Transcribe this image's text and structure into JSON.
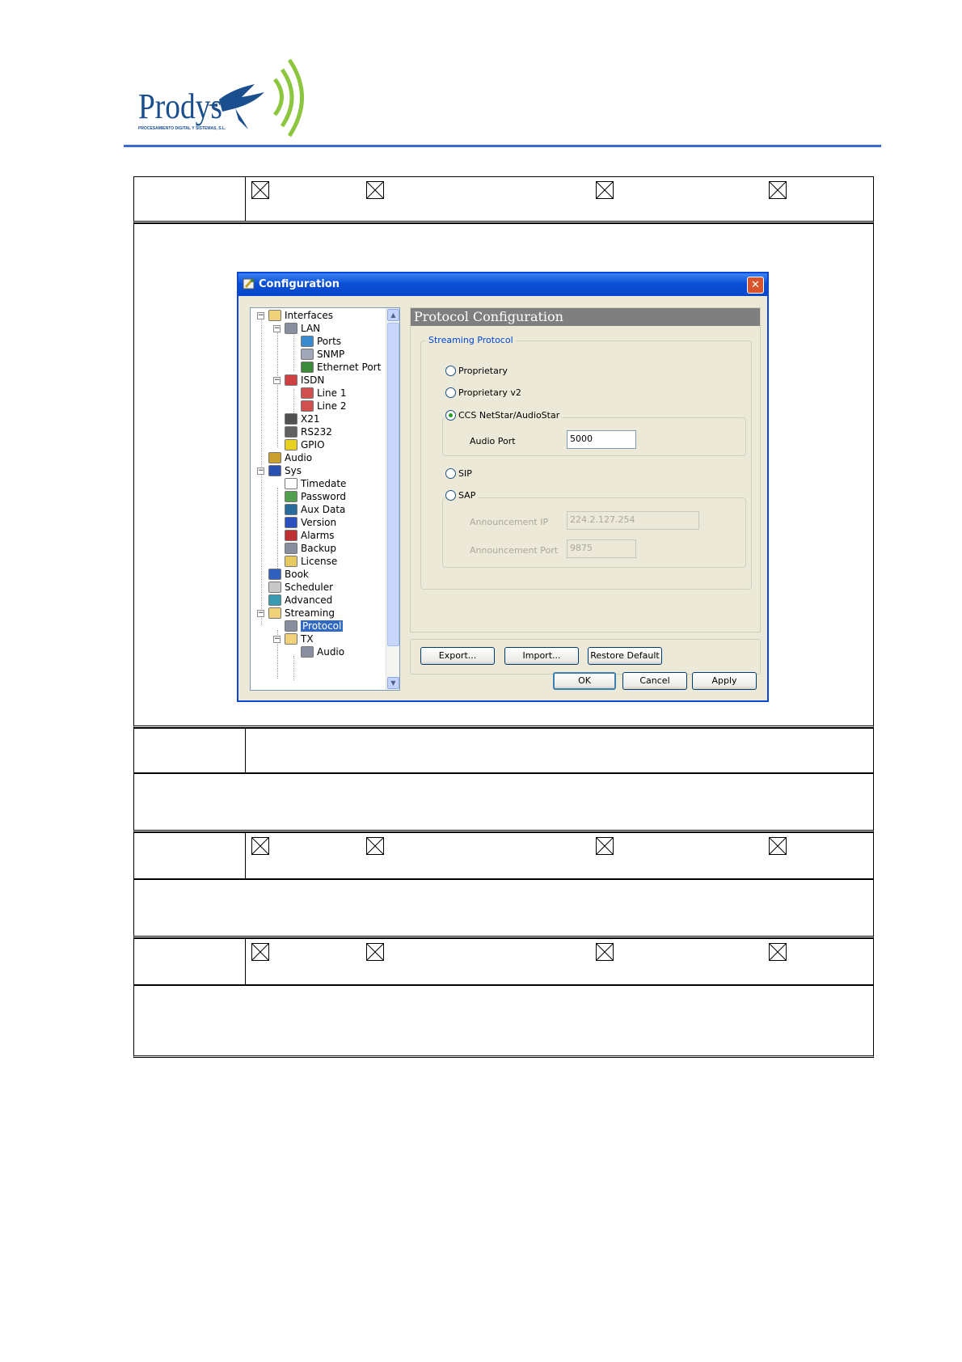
{
  "header": {
    "logo_text": "Prodys",
    "logo_subtitle": "PROCESAMIENTO DIGITAL Y SISTEMAS, S.L.",
    "accent_color": "#3a6ad4"
  },
  "dialog": {
    "title": "Configuration",
    "close_glyph": "✕",
    "tree": [
      {
        "label": "Interfaces",
        "icon": "folder-icon"
      },
      {
        "label": "LAN",
        "icon": "network-icon"
      },
      {
        "label": "Ports",
        "icon": "globe-icon"
      },
      {
        "label": "SNMP",
        "icon": "snmp-icon"
      },
      {
        "label": "Ethernet Port",
        "icon": "ethernet-icon"
      },
      {
        "label": "ISDN",
        "icon": "isdn-icon"
      },
      {
        "label": "Line 1",
        "icon": "line-icon"
      },
      {
        "label": "Line 2",
        "icon": "line-icon"
      },
      {
        "label": "X21",
        "icon": "x21-icon"
      },
      {
        "label": "RS232",
        "icon": "rs232-icon"
      },
      {
        "label": "GPIO",
        "icon": "gpio-icon"
      },
      {
        "label": "Audio",
        "icon": "speaker-icon"
      },
      {
        "label": "Sys",
        "icon": "monitor-icon"
      },
      {
        "label": "Timedate",
        "icon": "clock-icon"
      },
      {
        "label": "Password",
        "icon": "key-icon"
      },
      {
        "label": "Aux Data",
        "icon": "auxdata-icon"
      },
      {
        "label": "Version",
        "icon": "help-icon"
      },
      {
        "label": "Alarms",
        "icon": "alarm-icon"
      },
      {
        "label": "Backup",
        "icon": "network-icon"
      },
      {
        "label": "License",
        "icon": "lock-icon"
      },
      {
        "label": "Book",
        "icon": "book-icon"
      },
      {
        "label": "Scheduler",
        "icon": "scheduler-icon"
      },
      {
        "label": "Advanced",
        "icon": "advanced-icon"
      },
      {
        "label": "Streaming",
        "icon": "folder-icon"
      },
      {
        "label": "Protocol",
        "icon": "network-icon"
      },
      {
        "label": "TX",
        "icon": "folder-icon"
      },
      {
        "label": "Audio",
        "icon": "network-icon"
      }
    ],
    "panel": {
      "heading": "Protocol Configuration",
      "group_title": "Streaming Protocol",
      "options": [
        {
          "label": "Proprietary",
          "selected": false
        },
        {
          "label": "Proprietary v2",
          "selected": false
        },
        {
          "label": "CCS NetStar/AudioStar",
          "selected": true
        },
        {
          "label": "SIP",
          "selected": false
        },
        {
          "label": "SAP",
          "selected": false
        }
      ],
      "audio_port_label": "Audio Port",
      "audio_port_value": "5000",
      "announcement_ip_label": "Announcement IP",
      "announcement_ip_value": "224.2.127.254",
      "announcement_port_label": "Announcement Port",
      "announcement_port_value": "9875"
    },
    "buttons": {
      "export": "Export...",
      "import": "Import...",
      "restore": "Restore Default",
      "ok": "OK",
      "cancel": "Cancel",
      "apply": "Apply"
    }
  }
}
